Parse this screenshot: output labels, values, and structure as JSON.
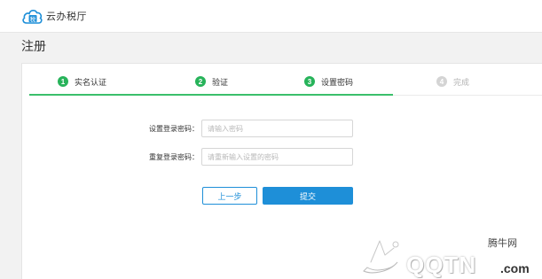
{
  "app": {
    "name": "云办税厅"
  },
  "page": {
    "title": "注册"
  },
  "steps": [
    {
      "number": "1",
      "label": "实名认证",
      "status": "done"
    },
    {
      "number": "2",
      "label": "验证",
      "status": "done"
    },
    {
      "number": "3",
      "label": "设置密码",
      "status": "done"
    },
    {
      "number": "4",
      "label": "完成",
      "status": "pending"
    }
  ],
  "form": {
    "password": {
      "label": "设置登录密码：",
      "placeholder": "请输入密码",
      "value": ""
    },
    "confirm": {
      "label": "重复登录密码：",
      "placeholder": "请重新输入设置的密码",
      "value": ""
    }
  },
  "buttons": {
    "prev": "上一步",
    "submit": "提交"
  },
  "watermark": {
    "top_text": "腾牛网",
    "main_text": "QQTN",
    "suffix": ".com"
  },
  "colors": {
    "accent": "#1e8fd8",
    "step_done": "#27b35a",
    "step_pending": "#d4d4d4",
    "progress": "#3bbf6b"
  }
}
